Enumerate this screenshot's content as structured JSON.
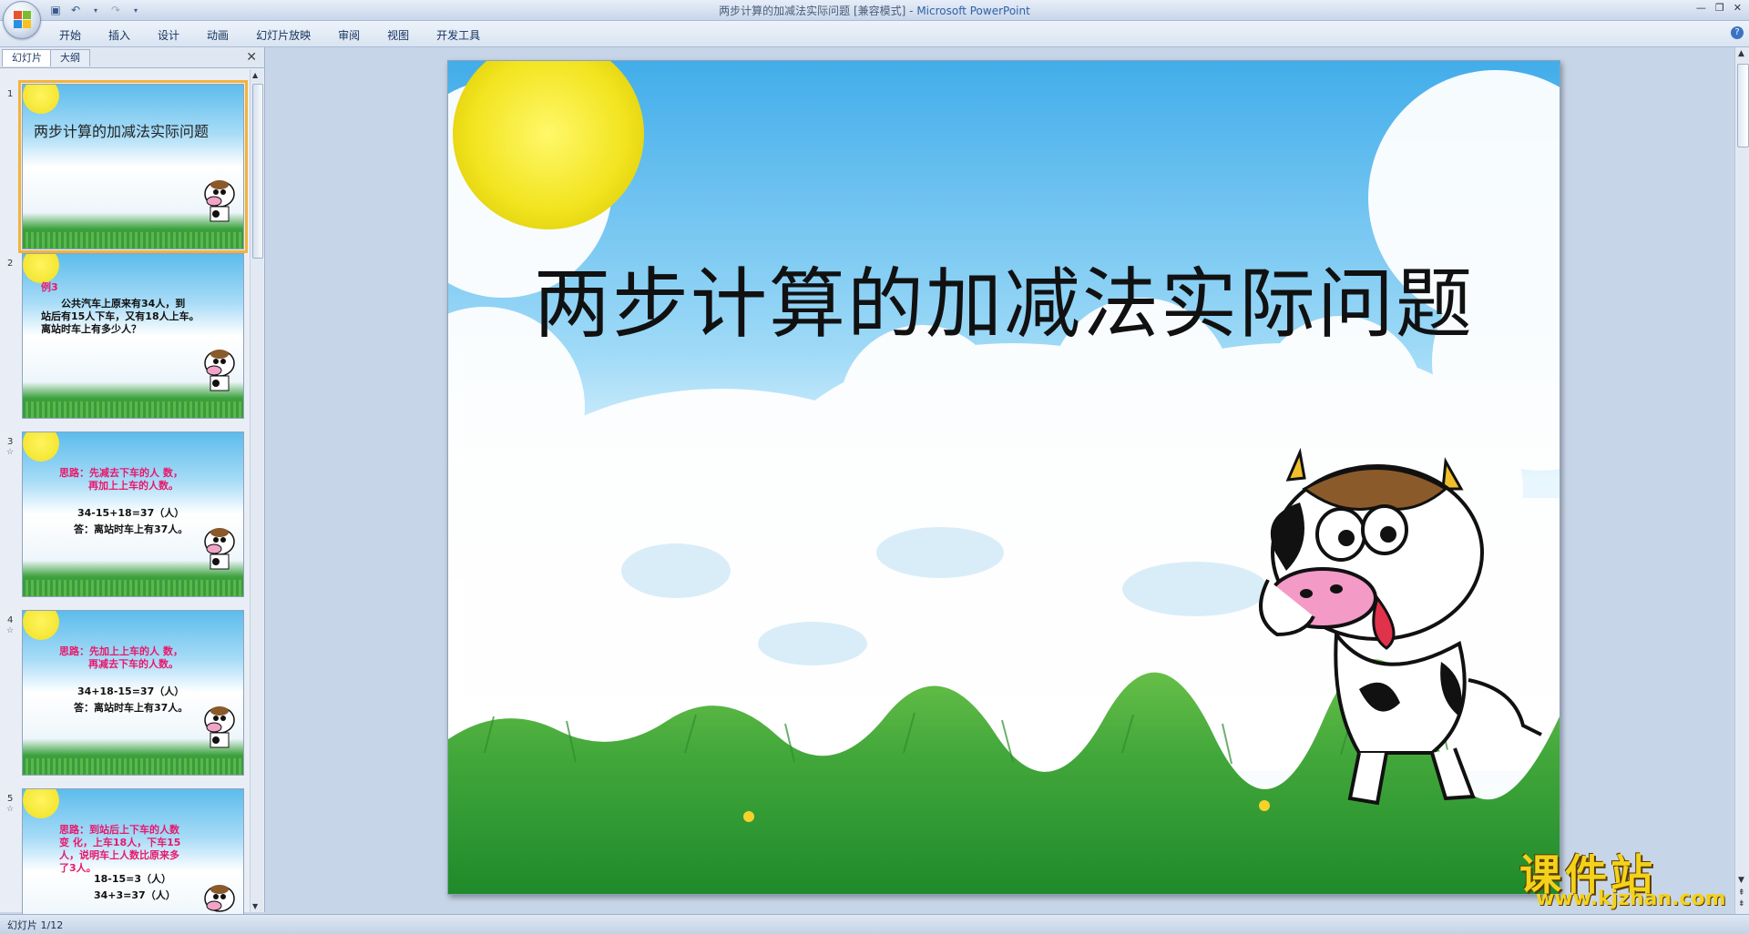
{
  "window": {
    "title_doc": "两步计算的加减法实际问题 [兼容模式] - ",
    "title_app": "Microsoft PowerPoint"
  },
  "ribbon": {
    "tabs": [
      "开始",
      "插入",
      "设计",
      "动画",
      "幻灯片放映",
      "审阅",
      "视图",
      "开发工具"
    ]
  },
  "panel": {
    "tab_slides": "幻灯片",
    "tab_outline": "大纲"
  },
  "slides": [
    {
      "num": "1",
      "title": "两步计算的加减法实际问题"
    },
    {
      "num": "2",
      "label": "例3",
      "lines": [
        "公共汽车上原来有34人，到",
        "站后有15人下车，又有18人上车。",
        "离站时车上有多少人？"
      ]
    },
    {
      "num": "3",
      "lines": [
        "思路：先减去下车的人 数，",
        "再加上上车的人数。",
        "34-15+18=37（人）",
        "答：离站时车上有37人。"
      ]
    },
    {
      "num": "4",
      "lines": [
        "思路：先加上上车的人 数，",
        "再减去下车的人数。",
        "34+18-15=37（人）",
        "答：离站时车上有37人。"
      ]
    },
    {
      "num": "5",
      "lines": [
        "思路：到站后上下车的人数",
        "变 化，上车18人，下车15",
        "人，说明车上人数比原来多",
        "了3人。",
        "18-15=3（人）",
        "34+3=37（人）"
      ]
    }
  ],
  "main_slide": {
    "title": "两步计算的加减法实际问题"
  },
  "status": {
    "slide_indicator": "幻灯片 1/12"
  },
  "watermark": {
    "name": "课件站",
    "url": "www.kjzhan.com"
  },
  "colors": {
    "sky_top": "#4fb6ec",
    "grass": "#3da23d",
    "sun": "#f5ec2a",
    "slide_text_pink": "#e8186c",
    "selection": "#f4b338"
  }
}
